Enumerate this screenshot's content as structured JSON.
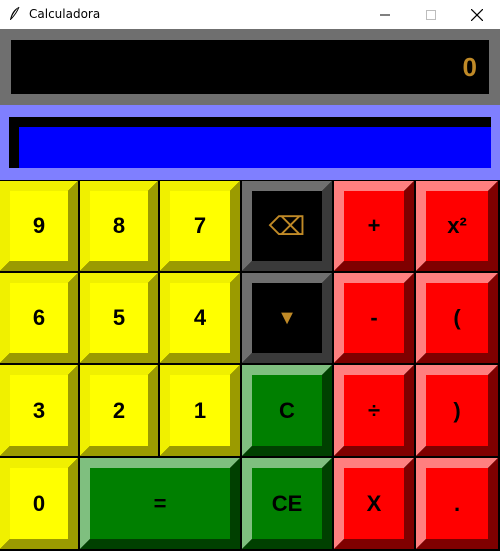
{
  "window": {
    "title": "Calculadora",
    "minimize_icon": "minimize-icon",
    "maximize_icon": "maximize-icon",
    "close_icon": "close-icon"
  },
  "display": {
    "value": "0",
    "value_color": "#c08a27"
  },
  "colors": {
    "yellow_face": "#ffff00",
    "yellow_light": "#f0f000",
    "yellow_dark": "#9b9b00",
    "gray_face": "#000000",
    "gray_light": "#6f6f6f",
    "gray_dark": "#3a3a3a",
    "green_face": "#007f00",
    "green_light": "#7fbf7f",
    "green_dark": "#004000",
    "red_face": "#ff0000",
    "red_light": "#ff7f7f",
    "red_dark": "#7f0000",
    "blue_bar": "#0000ff",
    "blue_border": "#7f7fff"
  },
  "buttons": {
    "b9": "9",
    "b8": "8",
    "b7": "7",
    "backspace": "⌫",
    "plus": "+",
    "square": "x²",
    "b6": "6",
    "b5": "5",
    "b4": "4",
    "down": "▼",
    "minus": "-",
    "lparen": "(",
    "b3": "3",
    "b2": "2",
    "b1": "1",
    "clear": "C",
    "divide": "÷",
    "rparen": ")",
    "b0": "0",
    "equals": "=",
    "clear_entry": "CE",
    "multiply": "X",
    "dot": "."
  }
}
